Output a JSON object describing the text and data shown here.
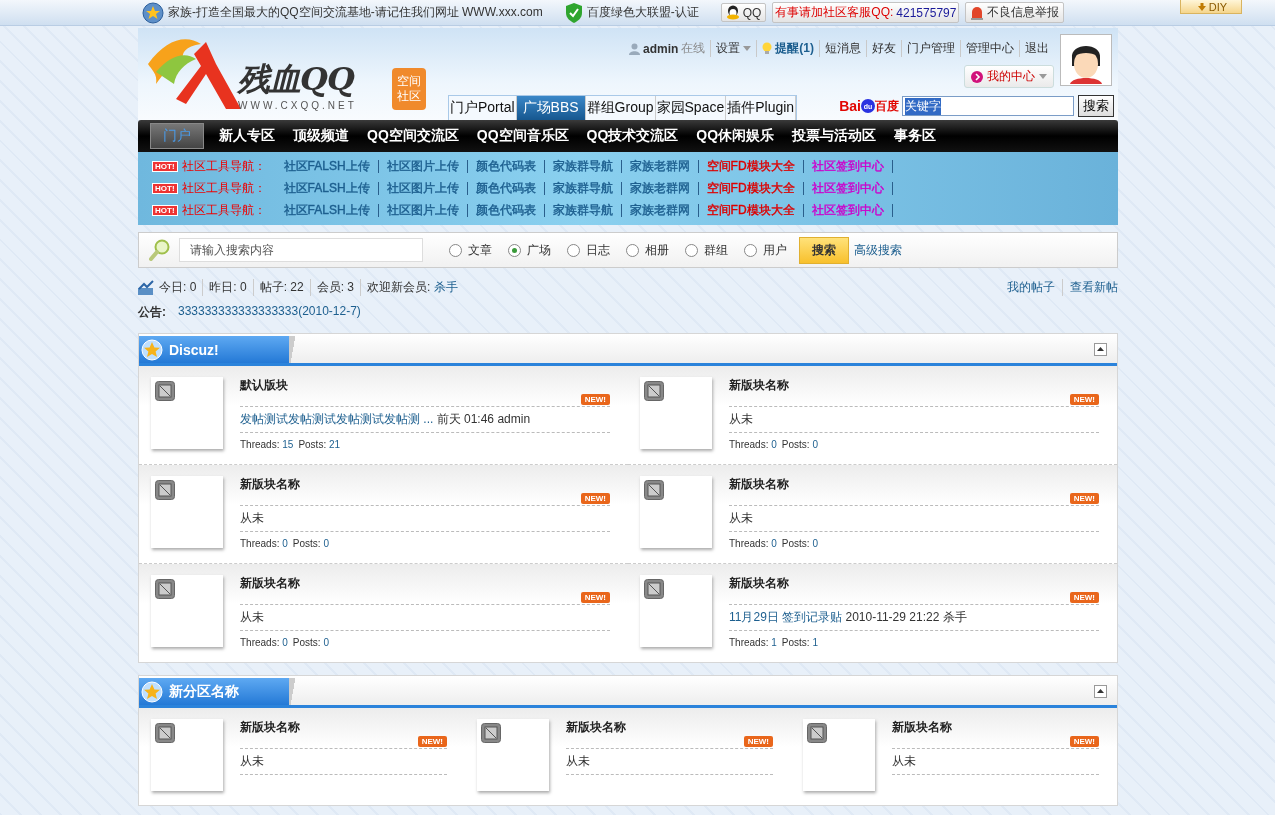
{
  "top_bar": {
    "items": [
      {
        "kind": "site",
        "text": "家族-打造全国最大的QQ空间交流基地-请记住我们网址 WWW.xxx.com"
      },
      {
        "kind": "alliance",
        "text": "百度绿色大联盟-认证"
      },
      {
        "kind": "qq",
        "text": "QQ"
      },
      {
        "kind": "service",
        "label": "有事请加社区客服QQ:",
        "number": "421575797"
      },
      {
        "kind": "report",
        "text": "不良信息举报"
      }
    ],
    "diy": "DIY"
  },
  "header": {
    "logo": {
      "name": "残血QQ",
      "badge": [
        "空间",
        "社区"
      ],
      "url": "WWW.CXQQ.NET"
    },
    "user_links": [
      {
        "kind": "user",
        "text": "admin",
        "status": "在线"
      },
      {
        "kind": "menu",
        "text": "设置"
      },
      {
        "kind": "notice",
        "text": "提醒(1)"
      },
      {
        "kind": "link",
        "text": "短消息"
      },
      {
        "kind": "link",
        "text": "好友"
      },
      {
        "kind": "link",
        "text": "门户管理"
      },
      {
        "kind": "link",
        "text": "管理中心"
      },
      {
        "kind": "link",
        "text": "退出"
      }
    ],
    "my_center": "我的中心",
    "channels": [
      {
        "label": "门户Portal",
        "selected": false
      },
      {
        "label": "广场BBS",
        "selected": true
      },
      {
        "label": "群组Group",
        "selected": false
      },
      {
        "label": "家园Space",
        "selected": false
      },
      {
        "label": "插件Plugin",
        "selected": false
      }
    ],
    "baidu": {
      "logo": [
        "Bai",
        "du",
        "百度"
      ],
      "value": "关键字",
      "button": "搜索"
    }
  },
  "nav": [
    {
      "label": "门户",
      "selected": true
    },
    {
      "label": "新人专区",
      "selected": false
    },
    {
      "label": "顶级频道",
      "selected": false
    },
    {
      "label": "QQ空间交流区",
      "selected": false
    },
    {
      "label": "QQ空间音乐区",
      "selected": false
    },
    {
      "label": "QQ技术交流区",
      "selected": false
    },
    {
      "label": "QQ休闲娱乐",
      "selected": false
    },
    {
      "label": "投票与活动区",
      "selected": false
    },
    {
      "label": "事务区",
      "selected": false
    }
  ],
  "tool_rows": [
    {
      "hot": "HOT!",
      "label": "社区工具导航：",
      "links": [
        {
          "text": "社区FALSH上传",
          "color": "#1d5f8f"
        },
        {
          "text": "社区图片上传",
          "color": "#1d5f8f"
        },
        {
          "text": "颜色代码表",
          "color": "#1d5f8f"
        },
        {
          "text": "家族群导航",
          "color": "#1d5f8f"
        },
        {
          "text": "家族老群网",
          "color": "#1d5f8f"
        },
        {
          "text": "空间FD模块大全",
          "color": "#dd0000"
        },
        {
          "text": "社区签到中心",
          "color": "#cc00cc"
        }
      ]
    },
    {
      "hot": "HOT!",
      "label": "社区工具导航：",
      "links": [
        {
          "text": "社区FALSH上传",
          "color": "#1d5f8f"
        },
        {
          "text": "社区图片上传",
          "color": "#1d5f8f"
        },
        {
          "text": "颜色代码表",
          "color": "#1d5f8f"
        },
        {
          "text": "家族群导航",
          "color": "#1d5f8f"
        },
        {
          "text": "家族老群网",
          "color": "#1d5f8f"
        },
        {
          "text": "空间FD模块大全",
          "color": "#dd0000"
        },
        {
          "text": "社区签到中心",
          "color": "#cc00cc"
        }
      ]
    },
    {
      "hot": "HOT!",
      "label": "社区工具导航：",
      "links": [
        {
          "text": "社区FALSH上传",
          "color": "#1d5f8f"
        },
        {
          "text": "社区图片上传",
          "color": "#1d5f8f"
        },
        {
          "text": "颜色代码表",
          "color": "#1d5f8f"
        },
        {
          "text": "家族群导航",
          "color": "#1d5f8f"
        },
        {
          "text": "家族老群网",
          "color": "#1d5f8f"
        },
        {
          "text": "空间FD模块大全",
          "color": "#dd0000"
        },
        {
          "text": "社区签到中心",
          "color": "#cc00cc"
        }
      ]
    }
  ],
  "search": {
    "placeholder": "请输入搜索内容",
    "options": [
      {
        "label": "文章",
        "selected": false
      },
      {
        "label": "广场",
        "selected": true
      },
      {
        "label": "日志",
        "selected": false
      },
      {
        "label": "相册",
        "selected": false
      },
      {
        "label": "群组",
        "selected": false
      },
      {
        "label": "用户",
        "selected": false
      }
    ],
    "button": "搜索",
    "advanced": "高级搜索"
  },
  "stats": {
    "items": [
      {
        "label": "今日:",
        "value": "0"
      },
      {
        "label": "昨日:",
        "value": "0"
      },
      {
        "label": "帖子:",
        "value": "22"
      },
      {
        "label": "会员:",
        "value": "3"
      }
    ],
    "newest": {
      "label": "欢迎新会员:",
      "name": "杀手"
    },
    "links": [
      "我的帖子",
      "查看新帖"
    ]
  },
  "announcement": {
    "label": "公告:",
    "text": "333333333333333333(2010-12-7)"
  },
  "categories": [
    {
      "title": "Discuz!",
      "collapsed": false,
      "rows": [
        [
          {
            "name": "默认版块",
            "badge": "NEW!",
            "last": {
              "kind": "post",
              "link": "发帖测试发帖测试发帖测试发帖测 ...",
              "meta": "前天 01:46 admin"
            },
            "stats": [
              {
                "label": "Threads:",
                "value": "15"
              },
              {
                "label": "Posts:",
                "value": "21"
              }
            ]
          },
          {
            "name": "新版块名称",
            "badge": "NEW!",
            "last": {
              "kind": "never",
              "text": "从未"
            },
            "stats": [
              {
                "label": "Threads:",
                "value": "0"
              },
              {
                "label": "Posts:",
                "value": "0"
              }
            ]
          }
        ],
        [
          {
            "name": "新版块名称",
            "badge": "NEW!",
            "last": {
              "kind": "never",
              "text": "从未"
            },
            "stats": [
              {
                "label": "Threads:",
                "value": "0"
              },
              {
                "label": "Posts:",
                "value": "0"
              }
            ]
          },
          {
            "name": "新版块名称",
            "badge": "NEW!",
            "last": {
              "kind": "never",
              "text": "从未"
            },
            "stats": [
              {
                "label": "Threads:",
                "value": "0"
              },
              {
                "label": "Posts:",
                "value": "0"
              }
            ]
          }
        ],
        [
          {
            "name": "新版块名称",
            "badge": "NEW!",
            "last": {
              "kind": "never",
              "text": "从未"
            },
            "stats": [
              {
                "label": "Threads:",
                "value": "0"
              },
              {
                "label": "Posts:",
                "value": "0"
              }
            ]
          },
          {
            "name": "新版块名称",
            "badge": "NEW!",
            "last": {
              "kind": "post",
              "link": "11月29日 签到记录贴",
              "meta": "2010-11-29 21:22 杀手"
            },
            "stats": [
              {
                "label": "Threads:",
                "value": "1"
              },
              {
                "label": "Posts:",
                "value": "1"
              }
            ]
          }
        ]
      ]
    },
    {
      "title": "新分区名称",
      "collapsed": false,
      "rows": [
        [
          {
            "name": "新版块名称",
            "badge": "NEW!",
            "last": {
              "kind": "never",
              "text": "从未"
            }
          },
          {
            "name": "新版块名称",
            "badge": "NEW!",
            "last": {
              "kind": "never",
              "text": "从未"
            }
          },
          {
            "name": "新版块名称",
            "badge": "NEW!",
            "last": {
              "kind": "never",
              "text": "从未"
            }
          }
        ]
      ]
    }
  ]
}
